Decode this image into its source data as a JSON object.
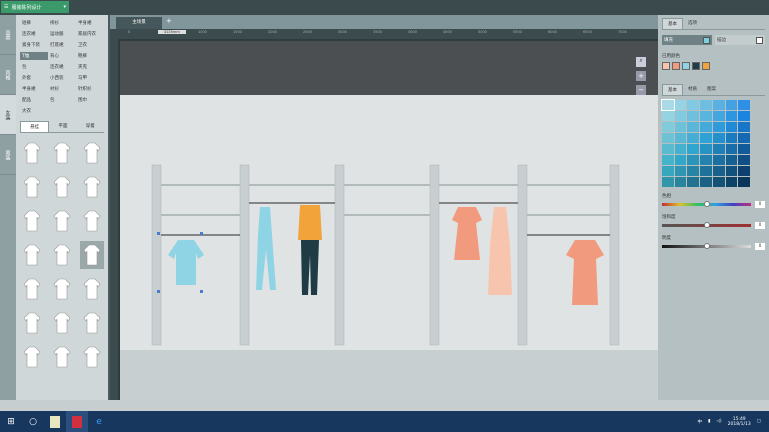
{
  "app": {
    "title": "服装陈列设计",
    "menu_icon": "hamburger-icon"
  },
  "left": {
    "vtabs": [
      "品类",
      "风格",
      "女装",
      "男装"
    ],
    "menu": [
      "短裤",
      "褂衫",
      "半身裙",
      "连衣裙",
      "运动服",
      "家居内衣",
      "紧身下装",
      "打底裙",
      "卫衣",
      "T恤",
      "背心",
      "靴裤",
      "包",
      "连衣裙",
      "夹克",
      "外套",
      "小西装",
      "马甲",
      "半身裙",
      "衬衫",
      "针织衫",
      "配品",
      "包",
      "围巾",
      "大衣"
    ],
    "subtabs": [
      "悬挂",
      "平面",
      "穿着"
    ]
  },
  "canvas": {
    "tab": "主场景",
    "add": "+",
    "ruler": [
      "0",
      "500",
      "1000",
      "1500",
      "2000",
      "2500",
      "3000",
      "3500",
      "4000",
      "4500",
      "5000",
      "5500",
      "6000",
      "6500",
      "7000"
    ],
    "ruler_marker": "1125mm"
  },
  "right": {
    "tabs": [
      "基本",
      "选项"
    ],
    "fill_label": "填充",
    "stroke_label": "描边",
    "fill_color": "#7fd0e0",
    "stroke_color": "#ffffff",
    "used_label": "已用颜色",
    "used_colors": [
      "#f7c4ae",
      "#f29a7e",
      "#8fd4e4",
      "#1f3b44",
      "#f2a33a"
    ],
    "color_tabs": [
      "基本",
      "材质",
      "图案"
    ],
    "sliders": [
      {
        "label": "色相",
        "value": "0",
        "pos": 0.5
      },
      {
        "label": "饱和度",
        "value": "0",
        "pos": 0.5
      },
      {
        "label": "明度",
        "value": "0",
        "pos": 0.5
      }
    ]
  },
  "taskbar": {
    "time": "15:49",
    "date": "2018/1/13",
    "lang": "中"
  }
}
